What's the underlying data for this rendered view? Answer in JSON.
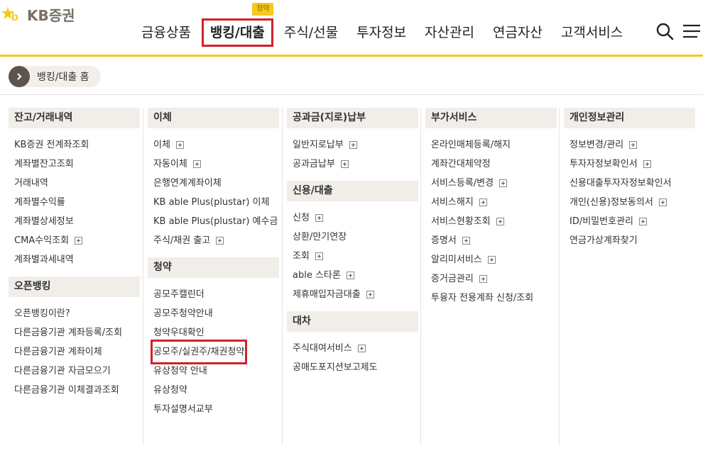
{
  "logo": {
    "text": "KB증권"
  },
  "nav": {
    "items": [
      "금융상품",
      "뱅킹/대출",
      "주식/선물",
      "투자정보",
      "자산관리",
      "연금자산",
      "고객서비스"
    ],
    "active_index": 1,
    "badge": "청약"
  },
  "header_icons": {
    "search": "search-icon",
    "menu": "hamburger-menu-icon"
  },
  "breadcrumb": {
    "label": "뱅킹/대출 홈",
    "icon": "chevron-right-icon"
  },
  "columns": [
    {
      "sections": [
        {
          "title": "잔고/거래내역",
          "items": [
            {
              "label": "KB증권 전계좌조회",
              "plus": false
            },
            {
              "label": "계좌별잔고조회",
              "plus": false
            },
            {
              "label": "거래내역",
              "plus": false
            },
            {
              "label": "계좌별수익률",
              "plus": false
            },
            {
              "label": "계좌별상세정보",
              "plus": false
            },
            {
              "label": "CMA수익조회",
              "plus": true
            },
            {
              "label": "계좌별과세내역",
              "plus": false
            }
          ]
        },
        {
          "title": "오픈뱅킹",
          "items": [
            {
              "label": "오픈뱅킹이란?",
              "plus": false
            },
            {
              "label": "다른금융기관 계좌등록/조회",
              "plus": false
            },
            {
              "label": "다른금융기관 계좌이체",
              "plus": false
            },
            {
              "label": "다른금융기관 자금모으기",
              "plus": false
            },
            {
              "label": "다른금융기관 이체결과조회",
              "plus": false
            }
          ]
        }
      ]
    },
    {
      "sections": [
        {
          "title": "이체",
          "items": [
            {
              "label": "이체",
              "plus": true
            },
            {
              "label": "자동이체",
              "plus": true
            },
            {
              "label": "은행연계계좌이체",
              "plus": false
            },
            {
              "label": "KB able Plus(plustar) 이체",
              "plus": false
            },
            {
              "label": "KB able Plus(plustar) 예수금",
              "plus": false
            },
            {
              "label": "주식/채권 출고",
              "plus": true
            }
          ]
        },
        {
          "title": "청약",
          "items": [
            {
              "label": "공모주캘린더",
              "plus": false
            },
            {
              "label": "공모주청약안내",
              "plus": false
            },
            {
              "label": "청약우대확인",
              "plus": false
            },
            {
              "label": "공모주/실권주/채권청약",
              "plus": false,
              "highlight": true
            },
            {
              "label": "유상청약 안내",
              "plus": false
            },
            {
              "label": "유상청약",
              "plus": false
            },
            {
              "label": "투자설명서교부",
              "plus": false
            }
          ]
        }
      ]
    },
    {
      "sections": [
        {
          "title": "공과금(지로)납부",
          "items": [
            {
              "label": "일반지로납부",
              "plus": true
            },
            {
              "label": "공과금납부",
              "plus": true
            }
          ]
        },
        {
          "title": "신용/대출",
          "items": [
            {
              "label": "신청",
              "plus": true
            },
            {
              "label": "상환/만기연장",
              "plus": false
            },
            {
              "label": "조회",
              "plus": true
            },
            {
              "label": "able 스타론",
              "plus": true
            },
            {
              "label": "제휴매입자금대출",
              "plus": true
            }
          ]
        },
        {
          "title": "대차",
          "items": [
            {
              "label": "주식대여서비스",
              "plus": true
            },
            {
              "label": "공매도포지션보고제도",
              "plus": false
            }
          ]
        }
      ]
    },
    {
      "sections": [
        {
          "title": "부가서비스",
          "items": [
            {
              "label": "온라인매체등록/해지",
              "plus": false
            },
            {
              "label": "계좌간대체약정",
              "plus": false
            },
            {
              "label": "서비스등록/변경",
              "plus": true
            },
            {
              "label": "서비스해지",
              "plus": true
            },
            {
              "label": "서비스현황조회",
              "plus": true
            },
            {
              "label": "증명서",
              "plus": true
            },
            {
              "label": "알리미서비스",
              "plus": true
            },
            {
              "label": "증거금관리",
              "plus": true
            },
            {
              "label": "투융자 전용계좌 신청/조회",
              "plus": false
            }
          ]
        }
      ]
    },
    {
      "sections": [
        {
          "title": "개인정보관리",
          "items": [
            {
              "label": "정보변경/관리",
              "plus": true
            },
            {
              "label": "투자자정보확인서",
              "plus": true
            },
            {
              "label": "신용대출투자자정보확인서",
              "plus": false
            },
            {
              "label": "개인(신용)정보동의서",
              "plus": true
            },
            {
              "label": "ID/비밀번호관리",
              "plus": true
            },
            {
              "label": "연금가상계좌찾기",
              "plus": false
            }
          ]
        }
      ]
    }
  ]
}
